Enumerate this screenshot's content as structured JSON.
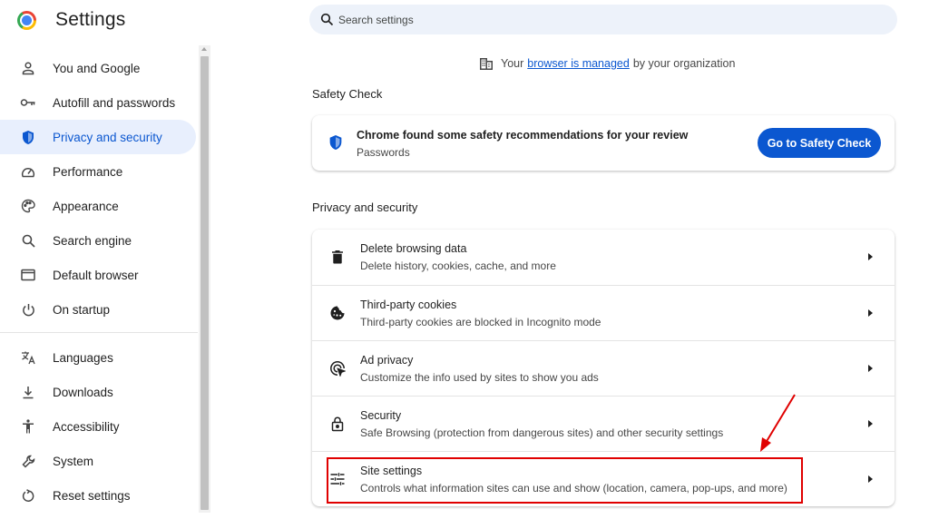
{
  "app": {
    "title": "Settings"
  },
  "search": {
    "placeholder": "Search settings"
  },
  "sidebar": {
    "items": [
      {
        "label": "You and Google",
        "icon": "person-icon",
        "active": false
      },
      {
        "label": "Autofill and passwords",
        "icon": "key-icon",
        "active": false
      },
      {
        "label": "Privacy and security",
        "icon": "shield-icon",
        "active": true
      },
      {
        "label": "Performance",
        "icon": "speedometer-icon",
        "active": false
      },
      {
        "label": "Appearance",
        "icon": "palette-icon",
        "active": false
      },
      {
        "label": "Search engine",
        "icon": "search-icon",
        "active": false
      },
      {
        "label": "Default browser",
        "icon": "browser-window-icon",
        "active": false
      },
      {
        "label": "On startup",
        "icon": "power-icon",
        "active": false
      },
      {
        "label": "Languages",
        "icon": "translate-icon",
        "active": false
      },
      {
        "label": "Downloads",
        "icon": "download-icon",
        "active": false
      },
      {
        "label": "Accessibility",
        "icon": "accessibility-icon",
        "active": false
      },
      {
        "label": "System",
        "icon": "wrench-icon",
        "active": false
      },
      {
        "label": "Reset settings",
        "icon": "reset-icon",
        "active": false
      }
    ]
  },
  "managed": {
    "prefix": "Your",
    "link": "browser is managed",
    "suffix": "by your organization"
  },
  "safety_check": {
    "section_title": "Safety Check",
    "title": "Chrome found some safety recommendations for your review",
    "subtitle": "Passwords",
    "button": "Go to Safety Check"
  },
  "privacy": {
    "section_title": "Privacy and security",
    "rows": [
      {
        "title": "Delete browsing data",
        "subtitle": "Delete history, cookies, cache, and more",
        "icon": "trash-icon"
      },
      {
        "title": "Third-party cookies",
        "subtitle": "Third-party cookies are blocked in Incognito mode",
        "icon": "cookie-icon"
      },
      {
        "title": "Ad privacy",
        "subtitle": "Customize the info used by sites to show you ads",
        "icon": "ad-privacy-icon"
      },
      {
        "title": "Security",
        "subtitle": "Safe Browsing (protection from dangerous sites) and other security settings",
        "icon": "lock-icon"
      },
      {
        "title": "Site settings",
        "subtitle": "Controls what information sites can use and show (location, camera, pop-ups, and more)",
        "icon": "sliders-icon"
      }
    ]
  },
  "colors": {
    "accent": "#0b57d0",
    "active_bg": "#e8effd",
    "annotation": "#e00000"
  }
}
